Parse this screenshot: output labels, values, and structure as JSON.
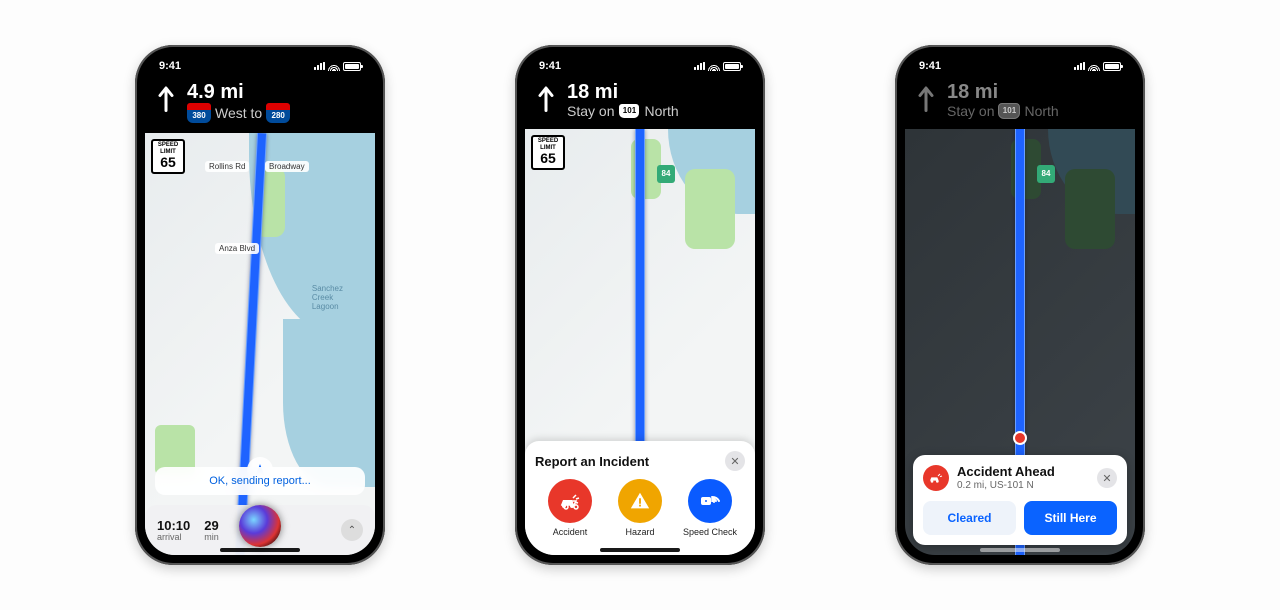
{
  "status": {
    "time": "9:41"
  },
  "phone1": {
    "distance": "4.9 mi",
    "dir_prefix": "West to",
    "shield1": "380",
    "shield2": "280",
    "speed_label": "SPEED\nLIMIT",
    "speed_value": "65",
    "labels": {
      "rollins": "Rollins Rd",
      "broadway": "Broadway",
      "anza": "Anza Blvd",
      "sanchez": "Sanchez\nCreek\nLagoon"
    },
    "siri_toast": "OK, sending report...",
    "eta": {
      "arrival_val": "10:10",
      "arrival_lbl": "arrival",
      "min_val": "29",
      "min_lbl": "min"
    }
  },
  "phone2": {
    "distance": "18 mi",
    "dir_prefix": "Stay on",
    "dir_suffix": "North",
    "shield": "101",
    "sr_shield": "84",
    "speed_label": "SPEED\nLIMIT",
    "speed_value": "65",
    "sheet_title": "Report an Incident",
    "incidents": {
      "accident": "Accident",
      "hazard": "Hazard",
      "speed": "Speed Check"
    }
  },
  "phone3": {
    "distance": "18 mi",
    "dir_prefix": "Stay on",
    "dir_suffix": "North",
    "shield": "101",
    "sr_shield": "84",
    "alert_title": "Accident Ahead",
    "alert_sub": "0.2 mi, US-101 N",
    "btn_cleared": "Cleared",
    "btn_still": "Still Here"
  }
}
